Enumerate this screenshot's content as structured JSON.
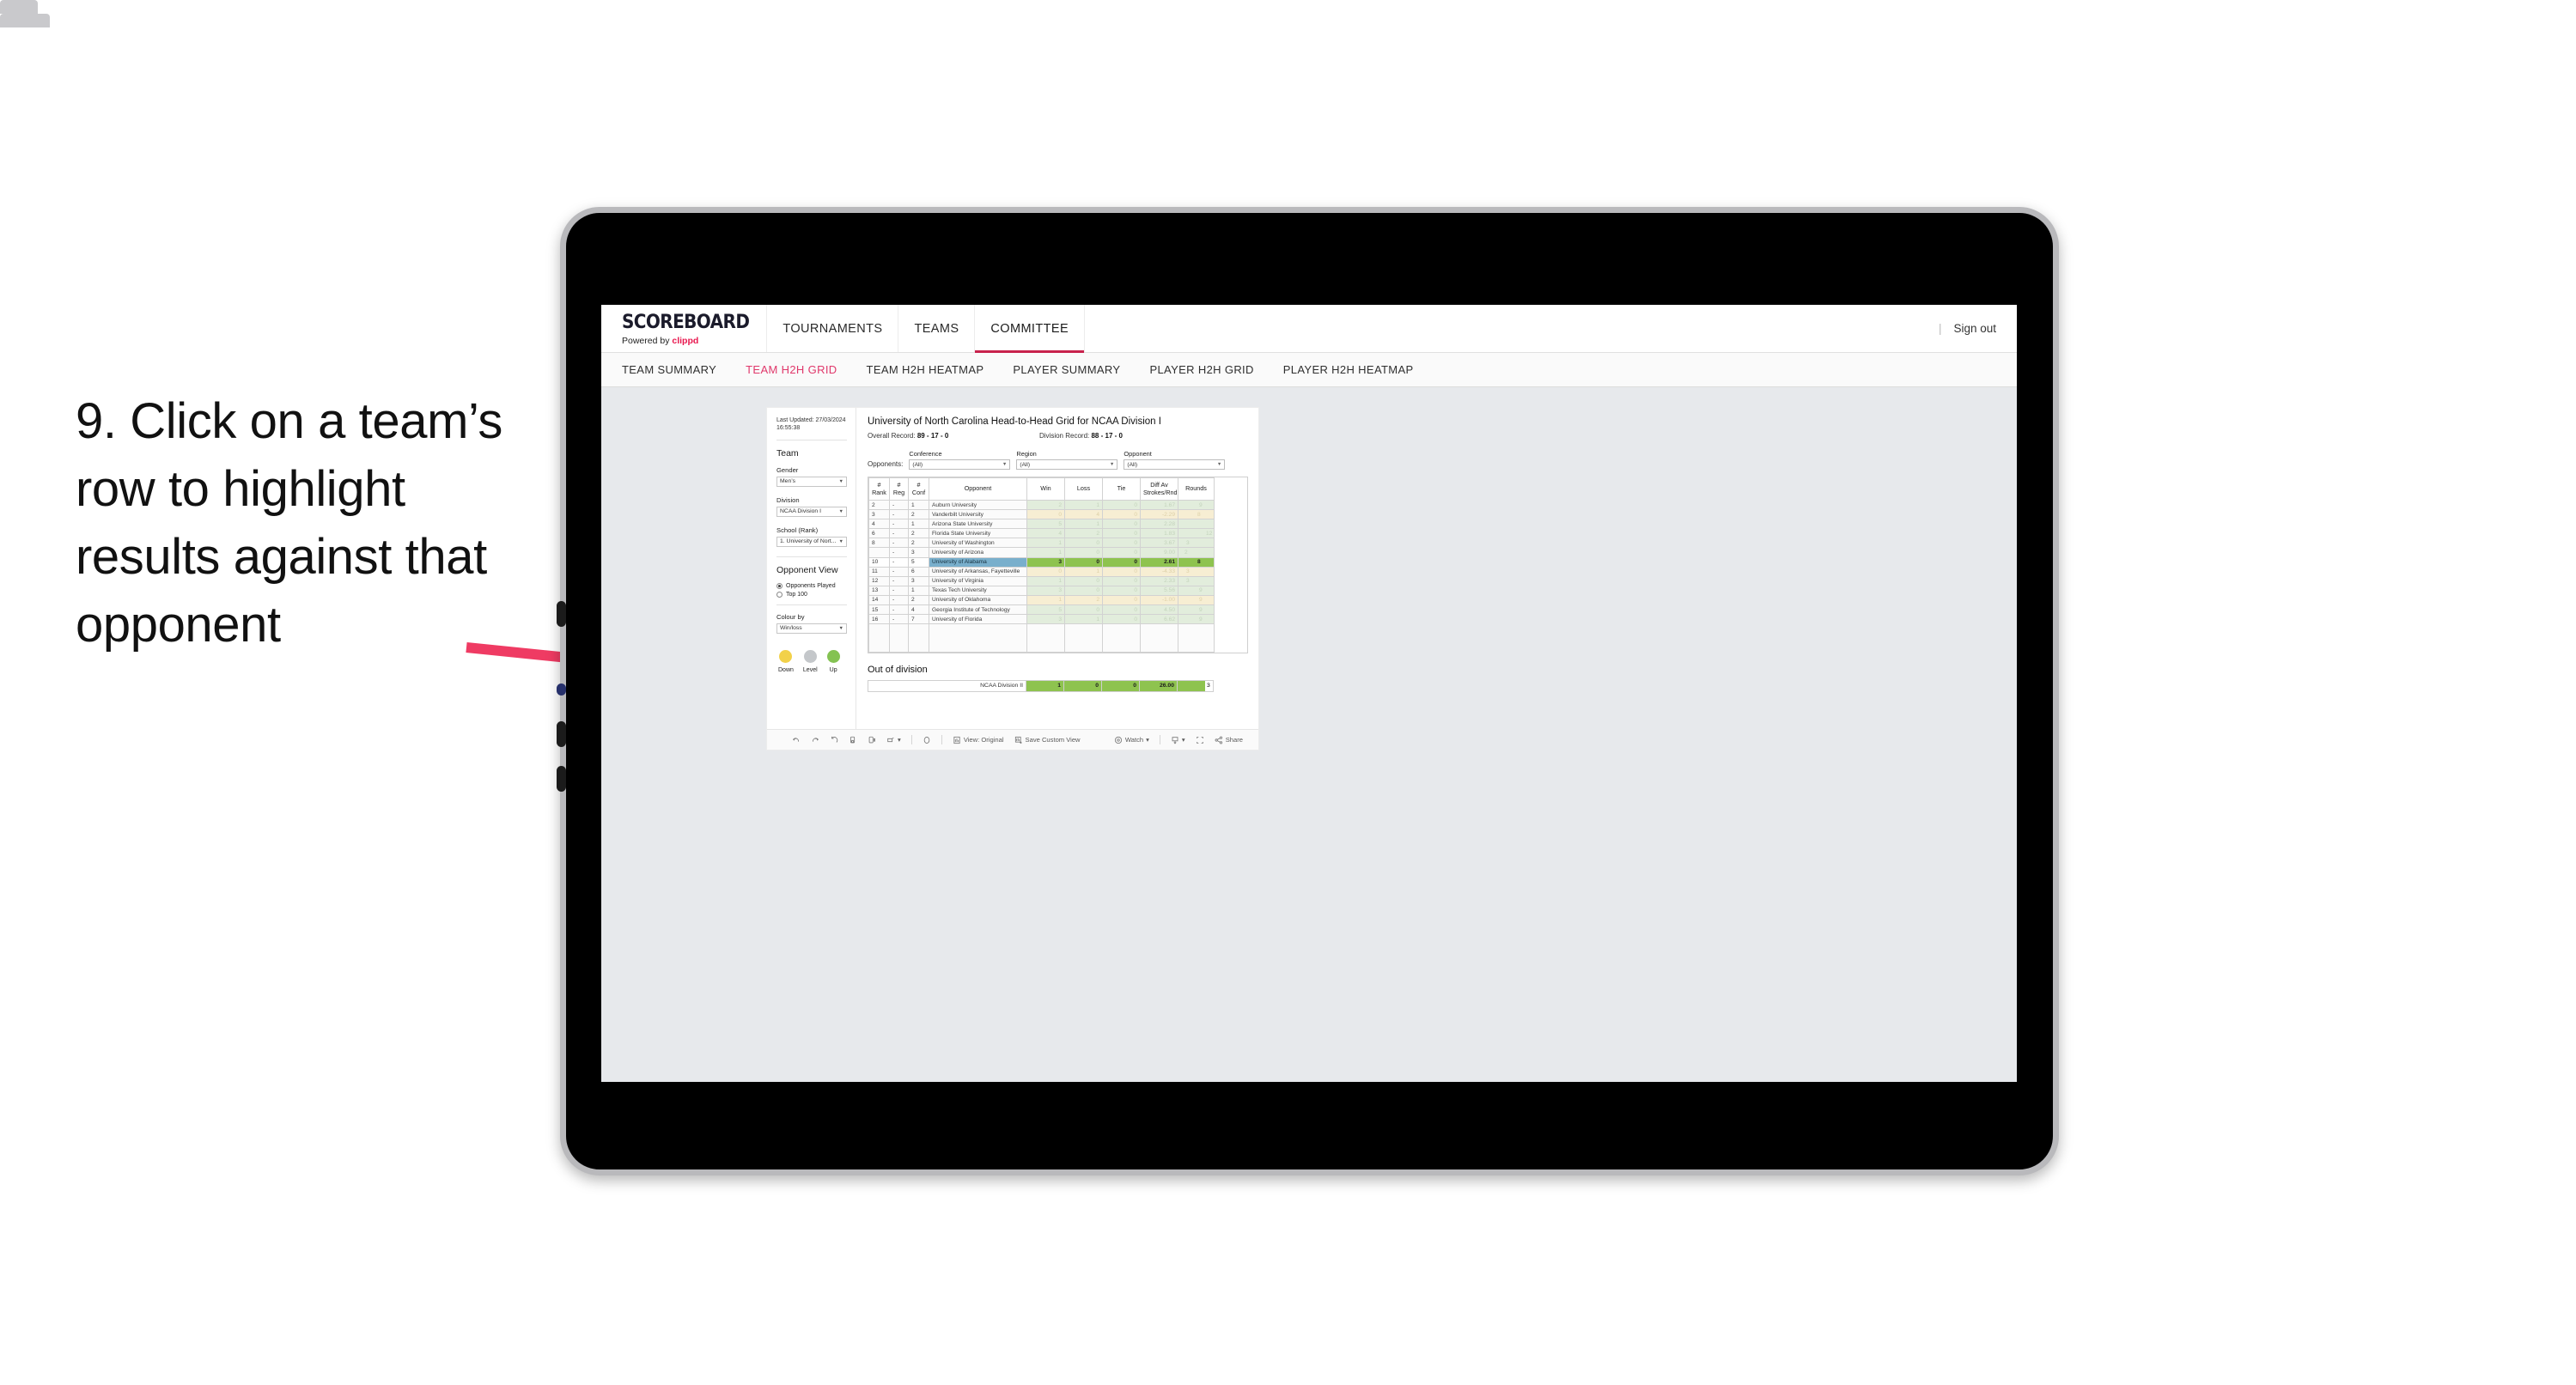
{
  "annotation": {
    "text": "9. Click on a team’s row to highlight results against that opponent",
    "arrow_color": "#ef3b63"
  },
  "topnav": {
    "brand_title": "SCOREBOARD",
    "brand_sub_prefix": "Powered by ",
    "brand_sub_name": "clippd",
    "items": [
      {
        "label": "TOURNAMENTS",
        "active": false
      },
      {
        "label": "TEAMS",
        "active": false
      },
      {
        "label": "COMMITTEE",
        "active": true
      }
    ],
    "divider": "|",
    "signout_label": "Sign out"
  },
  "subnav": {
    "items": [
      {
        "label": "TEAM SUMMARY",
        "active": false
      },
      {
        "label": "TEAM H2H GRID",
        "active": true
      },
      {
        "label": "TEAM H2H HEATMAP",
        "active": false
      },
      {
        "label": "PLAYER SUMMARY",
        "active": false
      },
      {
        "label": "PLAYER H2H GRID",
        "active": false
      },
      {
        "label": "PLAYER H2H HEATMAP",
        "active": false
      }
    ]
  },
  "sidebar": {
    "last_updated": "Last Updated: 27/03/2024 16:55:38",
    "team_heading": "Team",
    "gender_label": "Gender",
    "gender_value": "Men’s",
    "division_label": "Division",
    "division_value": "NCAA Division I",
    "school_label": "School (Rank)",
    "school_value": "1. University of Nort...",
    "opponent_view_heading": "Opponent View",
    "opponent_view_options": [
      {
        "label": "Opponents Played",
        "selected": true
      },
      {
        "label": "Top 100",
        "selected": false
      }
    ],
    "colour_by_label": "Colour by",
    "colour_by_value": "Win/loss",
    "legend": [
      {
        "label": "Down",
        "color": "#f2d14a"
      },
      {
        "label": "Level",
        "color": "#c4c7ca"
      },
      {
        "label": "Up",
        "color": "#84c252"
      }
    ]
  },
  "viz": {
    "title": "University of North Carolina Head-to-Head Grid for NCAA Division I",
    "overall_record_label": "Overall Record:",
    "overall_record_value": "89 - 17 - 0",
    "division_record_label": "Division Record:",
    "division_record_value": "88 - 17 - 0",
    "opponents_label": "Opponents:",
    "filters": [
      {
        "label": "Conference",
        "value": "(All)"
      },
      {
        "label": "Region",
        "value": "(All)"
      },
      {
        "label": "Opponent",
        "value": "(All)"
      }
    ],
    "out_of_division_title": "Out of division"
  },
  "chart_data": {
    "type": "table",
    "title": "University of North Carolina Head-to-Head Grid for NCAA Division I",
    "columns": [
      "# Rank",
      "# Reg",
      "# Conf",
      "Opponent",
      "Win",
      "Loss",
      "Tie",
      "Diff Av Strokes/Rnd",
      "Rounds"
    ],
    "column_headers_multiline": [
      [
        "#",
        "Rank"
      ],
      [
        "#",
        "Reg"
      ],
      [
        "#",
        "Conf"
      ],
      [
        "Opponent"
      ],
      [
        "Win"
      ],
      [
        "Loss"
      ],
      [
        "Tie"
      ],
      [
        "Diff Av",
        "Strokes/Rnd"
      ],
      [
        "Rounds"
      ]
    ],
    "rounds_max": 17,
    "rows": [
      {
        "rank": "2",
        "reg": "-",
        "conf": "1",
        "opponent": "Auburn University",
        "win": "2",
        "loss": "1",
        "tie": "0",
        "diff": "1.67",
        "rounds": "9",
        "rounds_n": 9,
        "state": "win"
      },
      {
        "rank": "3",
        "reg": "-",
        "conf": "2",
        "opponent": "Vanderbilt University",
        "win": "0",
        "loss": "4",
        "tie": "0",
        "diff": "-2.29",
        "rounds": "8",
        "rounds_n": 8,
        "state": "loss"
      },
      {
        "rank": "4",
        "reg": "-",
        "conf": "1",
        "opponent": "Arizona State University",
        "win": "5",
        "loss": "1",
        "tie": "0",
        "diff": "2.28",
        "rounds": "17",
        "rounds_n": 17,
        "state": "win"
      },
      {
        "rank": "6",
        "reg": "-",
        "conf": "2",
        "opponent": "Florida State University",
        "win": "4",
        "loss": "2",
        "tie": "0",
        "diff": "1.83",
        "rounds": "12",
        "rounds_n": 12,
        "state": "win"
      },
      {
        "rank": "8",
        "reg": "-",
        "conf": "2",
        "opponent": "University of Washington",
        "win": "1",
        "loss": "0",
        "tie": "0",
        "diff": "3.67",
        "rounds": "3",
        "rounds_n": 3,
        "state": "win"
      },
      {
        "rank": "",
        "reg": "-",
        "conf": "3",
        "opponent": "University of Arizona",
        "win": "1",
        "loss": "0",
        "tie": "0",
        "diff": "9.00",
        "rounds": "2",
        "rounds_n": 2,
        "state": "win"
      },
      {
        "rank": "10",
        "reg": "-",
        "conf": "5",
        "opponent": "University of Alabama",
        "win": "3",
        "loss": "0",
        "tie": "0",
        "diff": "2.61",
        "rounds": "8",
        "rounds_n": 8,
        "state": "selected"
      },
      {
        "rank": "11",
        "reg": "-",
        "conf": "6",
        "opponent": "University of Arkansas, Fayetteville",
        "win": "0",
        "loss": "1",
        "tie": "0",
        "diff": "-4.33",
        "rounds": "3",
        "rounds_n": 3,
        "state": "loss"
      },
      {
        "rank": "12",
        "reg": "-",
        "conf": "3",
        "opponent": "University of Virginia",
        "win": "1",
        "loss": "0",
        "tie": "0",
        "diff": "2.33",
        "rounds": "3",
        "rounds_n": 3,
        "state": "win"
      },
      {
        "rank": "13",
        "reg": "-",
        "conf": "1",
        "opponent": "Texas Tech University",
        "win": "3",
        "loss": "0",
        "tie": "0",
        "diff": "5.56",
        "rounds": "9",
        "rounds_n": 9,
        "state": "win"
      },
      {
        "rank": "14",
        "reg": "-",
        "conf": "2",
        "opponent": "University of Oklahoma",
        "win": "1",
        "loss": "2",
        "tie": "0",
        "diff": "-1.00",
        "rounds": "9",
        "rounds_n": 9,
        "state": "loss"
      },
      {
        "rank": "15",
        "reg": "-",
        "conf": "4",
        "opponent": "Georgia Institute of Technology",
        "win": "5",
        "loss": "0",
        "tie": "0",
        "diff": "4.50",
        "rounds": "9",
        "rounds_n": 9,
        "state": "win"
      },
      {
        "rank": "16",
        "reg": "-",
        "conf": "7",
        "opponent": "University of Florida",
        "win": "3",
        "loss": "1",
        "tie": "0",
        "diff": "6.62",
        "rounds": "9",
        "rounds_n": 9,
        "state": "win"
      }
    ],
    "out_of_division": {
      "label": "NCAA Division II",
      "win": "1",
      "loss": "0",
      "tie": "0",
      "diff": "26.00",
      "rounds": "3",
      "rounds_n": 3
    }
  },
  "toolbar": {
    "view_label": "View: Original",
    "save_label": "Save Custom View",
    "watch_label": "Watch",
    "share_label": "Share",
    "caret": "▾"
  }
}
